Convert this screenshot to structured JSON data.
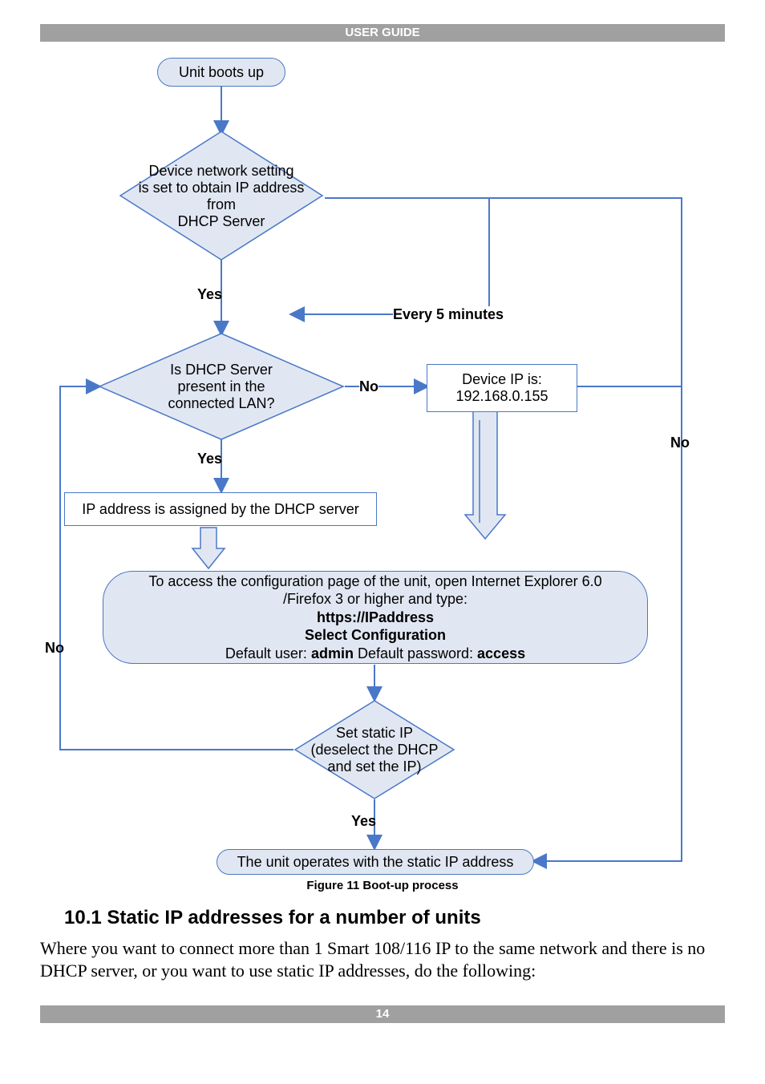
{
  "header": {
    "title": "USER GUIDE"
  },
  "footer": {
    "page": "14"
  },
  "flow": {
    "start": "Unit boots up",
    "d1_l1": "Device network setting",
    "d1_l2": "is set to obtain IP address from",
    "d1_l3": "DHCP Server",
    "d2_l1": "Is DHCP Server",
    "d2_l2": "present in the",
    "d2_l3": "connected LAN?",
    "ip_l1": "Device IP is:",
    "ip_l2": "192.168.0.155",
    "assigned": "IP address is assigned by the DHCP server",
    "cfg_l1": "To access the configuration page of the unit, open Internet Explorer 6.0",
    "cfg_l2": "/Firefox 3 or higher and type:",
    "cfg_l3": "https://IPaddress",
    "cfg_l4": "Select Configuration",
    "cfg_l5a": "Default user: ",
    "cfg_l5b": "admin",
    "cfg_l5c": " Default password: ",
    "cfg_l5d": "access",
    "d3_l1": "Set static IP",
    "d3_l2": "(deselect the DHCP",
    "d3_l3": "and set the IP)",
    "final": "The unit operates with the static IP address",
    "yes": "Yes",
    "no": "No",
    "every5": "Every 5 minutes"
  },
  "caption": "Figure 11 Boot-up process",
  "section": {
    "heading": "10.1 Static IP addresses for a number of units",
    "para": "Where you want to connect more than 1 Smart 108/116 IP to the same network and there is no DHCP server, or you want to use static IP addresses, do the following:"
  }
}
